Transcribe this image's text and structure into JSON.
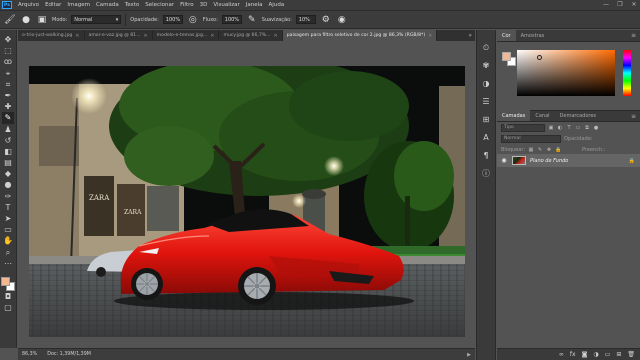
{
  "menu": {
    "logo": "Ps",
    "items": [
      "Arquivo",
      "Editar",
      "Imagem",
      "Camada",
      "Texto",
      "Selecionar",
      "Filtro",
      "3D",
      "Visualizar",
      "Janela",
      "Ajuda"
    ],
    "window_controls": [
      "—",
      "❐",
      "✕"
    ]
  },
  "options": {
    "mode_label": "Modo:",
    "mode_value": "Normal",
    "opacity_label": "Opacidade:",
    "opacity_value": "100%",
    "flow_label": "Fluxo:",
    "flow_value": "100%",
    "smoothing_label": "Suavização:",
    "smoothing_value": "10%"
  },
  "tabs": [
    {
      "label": "o-trio-just-walking.jpg",
      "active": false
    },
    {
      "label": "amor-e-vaz.jpg @ 81...",
      "active": false
    },
    {
      "label": "modelo-e-temas.jpg...",
      "active": false
    },
    {
      "label": "mucy.jpg @ 66,7%...",
      "active": false
    },
    {
      "label": "paisagem para filtro seletivo de cor 2.jpg @ 86,3% (RGB/8*)",
      "active": true
    }
  ],
  "status": {
    "zoom": "86,3%",
    "doc": "Doc: 1,39M/1,39M"
  },
  "color_panel": {
    "tabs": [
      "Cor",
      "Amostras"
    ],
    "fg_color": "#f1b893",
    "bg_color": "#ffffff"
  },
  "layers_panel": {
    "tabs": [
      "Camadas",
      "Canal",
      "Demarcadores"
    ],
    "filter_placeholder": "Tipo",
    "blend_mode": "Normal",
    "opacity_label": "Opacidade:",
    "lock_label": "Bloquear:",
    "fill_label": "Preench.:",
    "layer_name": "Plano de Fundo"
  },
  "canvas": {
    "signs": [
      "ZARA",
      "ZARA"
    ]
  }
}
